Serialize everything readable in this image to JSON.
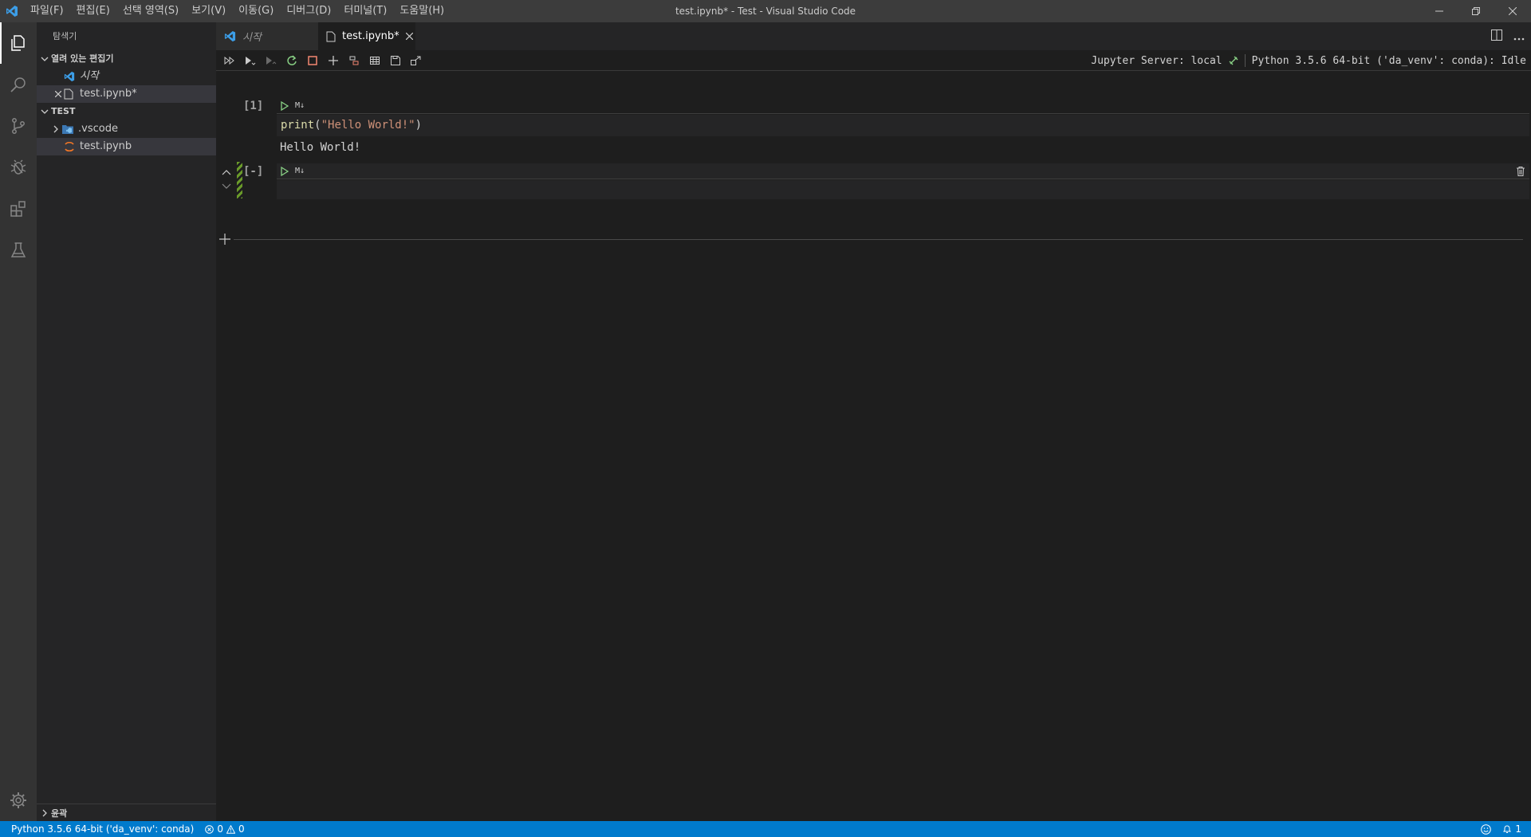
{
  "window": {
    "title": "test.ipynb* - Test - Visual Studio Code"
  },
  "menu": [
    "파일(F)",
    "편집(E)",
    "선택 영역(S)",
    "보기(V)",
    "이동(G)",
    "디버그(D)",
    "터미널(T)",
    "도움말(H)"
  ],
  "sidebar": {
    "title": "탐색기",
    "open_editors_label": "열려 있는 편집기",
    "open_editors": [
      {
        "label": "시작"
      },
      {
        "label": "test.ipynb*"
      }
    ],
    "folder_label": "TEST",
    "files": [
      {
        "label": ".vscode"
      },
      {
        "label": "test.ipynb"
      }
    ],
    "outline_label": "윤곽"
  },
  "tabs": [
    {
      "label": "시작"
    },
    {
      "label": "test.ipynb*"
    }
  ],
  "notebook": {
    "server_status": "Jupyter Server: local",
    "kernel_status": "Python 3.5.6 64-bit ('da_venv': conda): Idle",
    "cells": [
      {
        "count": "[1]",
        "cell_type_label": "M↓",
        "code_fn": "print",
        "code_open": "(",
        "code_str": "\"Hello World!\"",
        "code_close": ")",
        "output": "Hello World!"
      },
      {
        "count": "[-]",
        "cell_type_label": "M↓"
      }
    ]
  },
  "statusbar": {
    "interpreter": "Python 3.5.6 64-bit ('da_venv': conda)",
    "errors": "0",
    "warnings": "0",
    "notifications": "1"
  },
  "colors": {
    "accent": "#007acc",
    "run_green": "#89d185",
    "string": "#ce9178",
    "function": "#dcdcaa"
  }
}
